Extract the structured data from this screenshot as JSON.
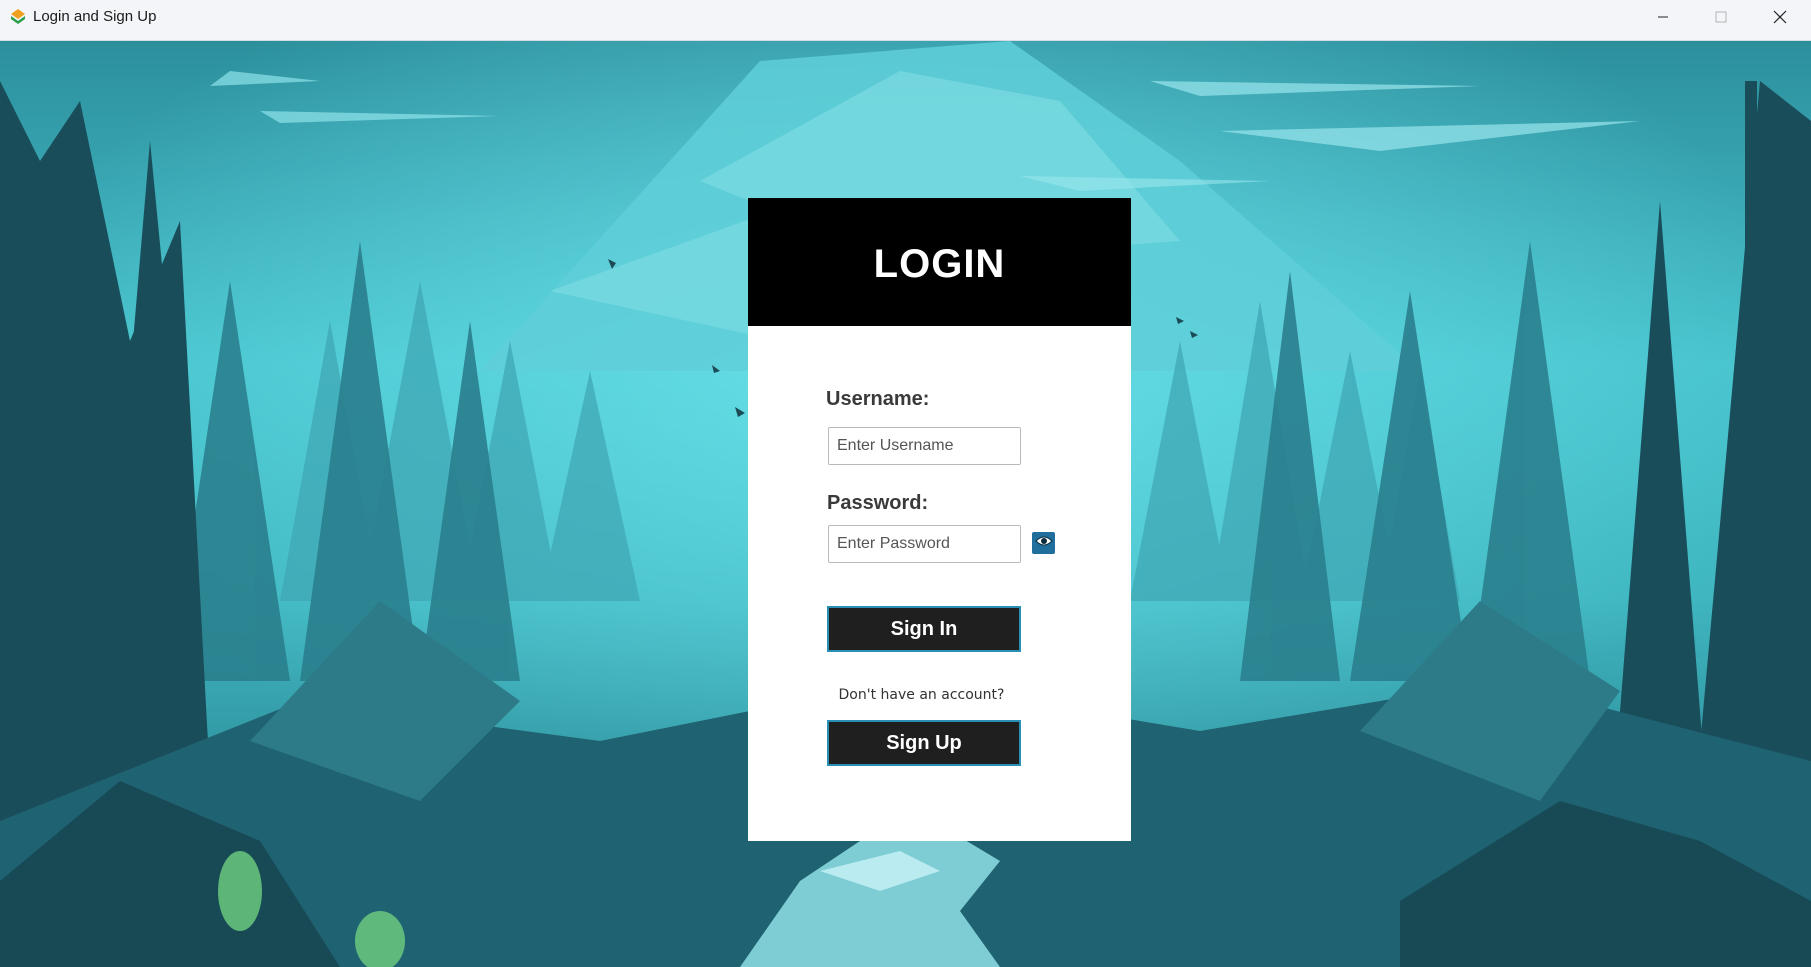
{
  "window": {
    "title": "Login and Sign Up",
    "app_icon": "app-logo-icon",
    "controls": {
      "minimize_icon": "minimize-icon",
      "maximize_icon": "maximize-icon",
      "close_icon": "close-icon"
    }
  },
  "background": {
    "description_icon": "forest-scene"
  },
  "login": {
    "title": "LOGIN",
    "username": {
      "label": "Username:",
      "placeholder": "Enter Username",
      "value": ""
    },
    "password": {
      "label": "Password:",
      "placeholder": "Enter Password",
      "value": "",
      "toggle_icon": "eye-icon"
    },
    "sign_in_label": "Sign In",
    "no_account_text": "Don't have an account?",
    "sign_up_label": "Sign Up"
  },
  "colors": {
    "card_header": "#000000",
    "button_bg": "#1f1f1f",
    "button_border": "#2a8fb5",
    "eye_toggle_bg": "#1f6e9c",
    "scene_primary": "#3ec6cf",
    "scene_dark": "#1c4a57"
  }
}
